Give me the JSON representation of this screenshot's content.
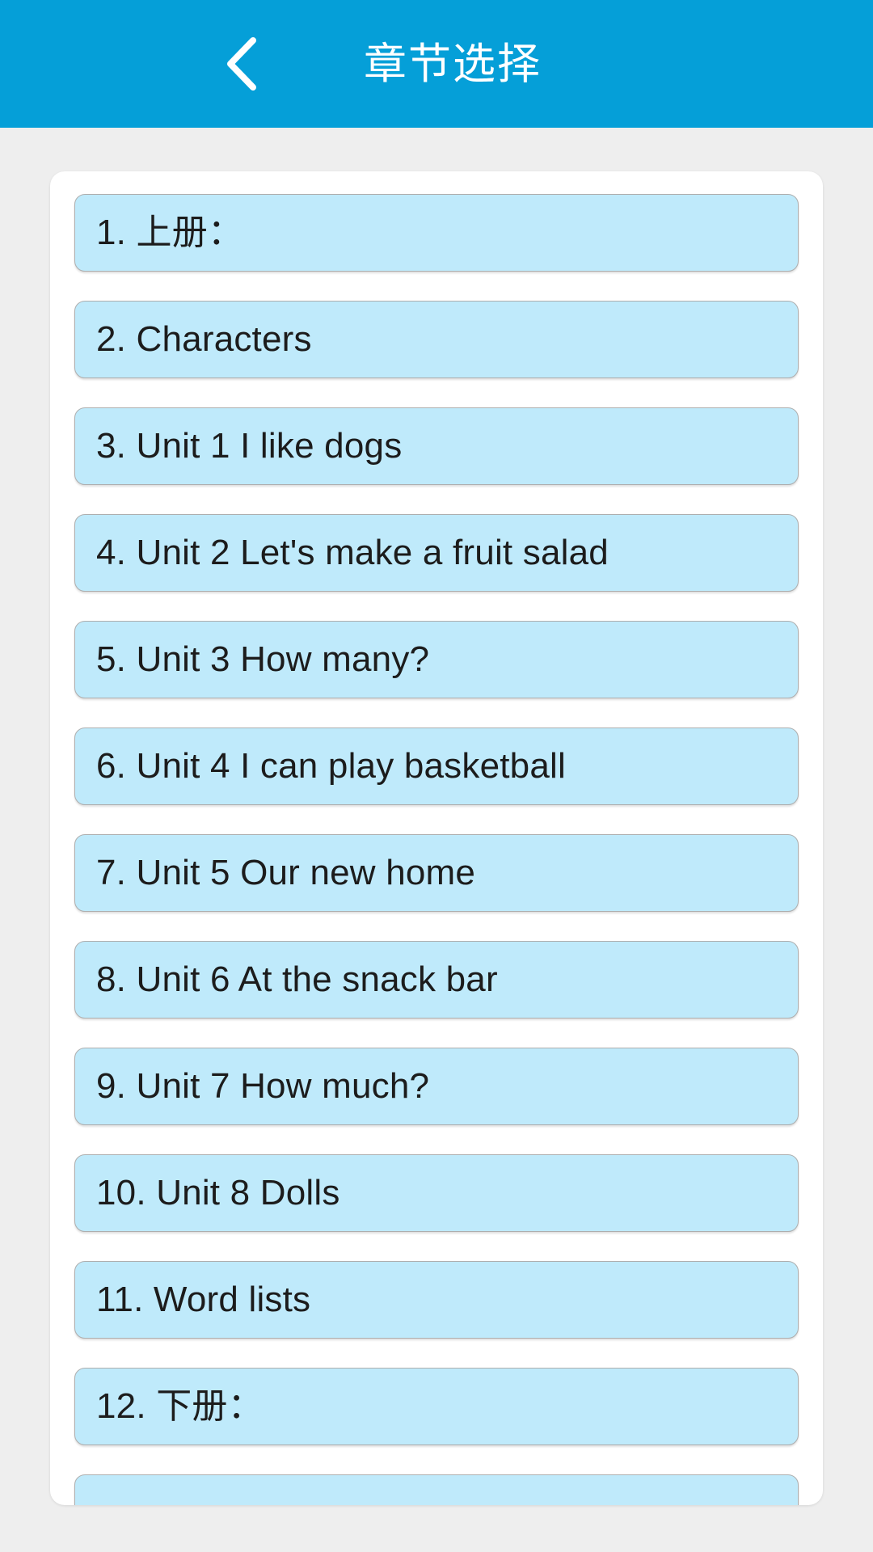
{
  "header": {
    "title": "章节选择",
    "back_icon": "chevron-left-icon",
    "background_color": "#059fd8",
    "text_color": "#ffffff"
  },
  "theme": {
    "page_background": "#eeeeee",
    "card_background": "#ffffff",
    "item_background": "#bfeafb",
    "item_border": "#aeaeae",
    "item_text": "#1c1c1c"
  },
  "chapter_list": {
    "items": [
      {
        "label": "1. 上册："
      },
      {
        "label": "2. Characters"
      },
      {
        "label": "3. Unit 1 I like dogs"
      },
      {
        "label": "4. Unit 2 Let's make a fruit salad"
      },
      {
        "label": "5. Unit 3 How many?"
      },
      {
        "label": "6. Unit 4 I can play basketball"
      },
      {
        "label": "7. Unit 5 Our new home"
      },
      {
        "label": "8. Unit 6 At the snack bar"
      },
      {
        "label": "9. Unit 7 How much?"
      },
      {
        "label": "10. Unit 8 Dolls"
      },
      {
        "label": "11. Word lists"
      },
      {
        "label": "12. 下册："
      },
      {
        "label": ""
      }
    ]
  }
}
